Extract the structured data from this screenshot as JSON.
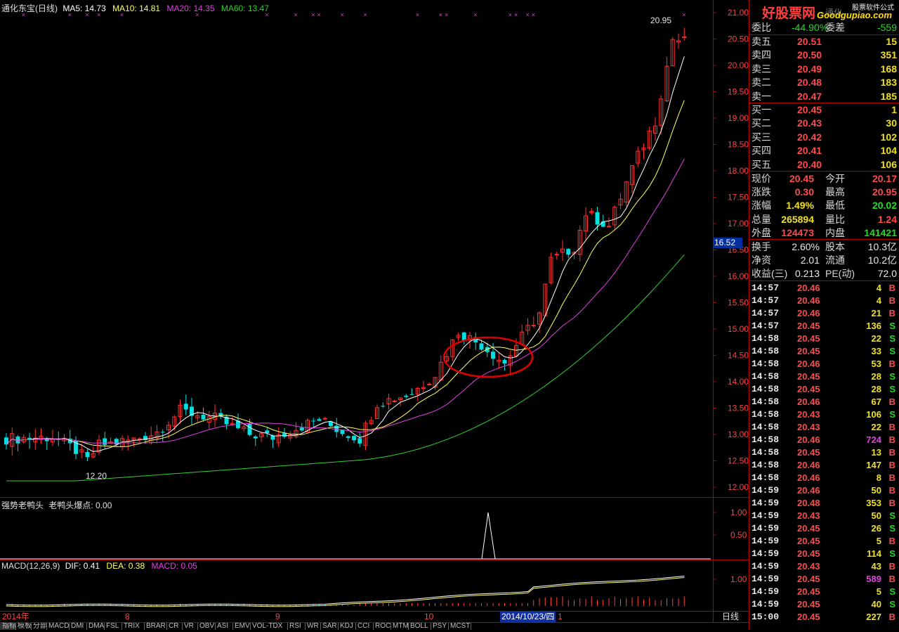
{
  "header": {
    "title": "通化东宝(日线)",
    "ma5": "MA5: 14.73",
    "ma10": "MA10: 14.81",
    "ma20": "MA20: 14.35",
    "ma60": "MA60: 13.47"
  },
  "price_axis": [
    "21.00",
    "20.50",
    "20.00",
    "19.50",
    "19.00",
    "18.50",
    "18.00",
    "17.50",
    "17.00",
    "16.50",
    "16.00",
    "15.50",
    "15.00",
    "14.50",
    "14.00",
    "13.50",
    "13.00",
    "12.50",
    "12.00"
  ],
  "cursor_price": "16.52",
  "high_label": "20.95",
  "low_label": "12.20",
  "indicator1": {
    "name": "强势老鸭头",
    "value_label": "老鸭头爆点: 0.00",
    "axis": [
      "1.00",
      "0.50"
    ]
  },
  "macd": {
    "name": "MACD(12,26,9)",
    "dif": "DIF: 0.41",
    "dea": "DEA: 0.38",
    "macd": "MACD: 0.05",
    "axis": [
      "1.00"
    ]
  },
  "time_axis": {
    "year": "2014年",
    "m8": "8",
    "m9": "9",
    "m10": "10",
    "cursor_date": "2014/10/23/四",
    "m11": "1",
    "period": "日线"
  },
  "tabs": [
    "指标",
    "模板",
    "分部",
    "MACD",
    "DMI",
    "DMA",
    "FSL",
    "TRIX",
    "BRAR",
    "CR",
    "VR",
    "OBV",
    "ASI",
    "EMV",
    "VOL-TDX",
    "RSI",
    "WR",
    "SAR",
    "KDJ",
    "CCI",
    "ROC",
    "MTM",
    "BOLL",
    "PSY",
    "MCST"
  ],
  "watermark": {
    "brand": "好股票网",
    "url": "Goodgupiao.com",
    "note": "股票软件公式",
    "name": "通化"
  },
  "ratio": {
    "label1": "委比",
    "value1": "-44.90%",
    "label2": "委差",
    "value2": "-559"
  },
  "sell": [
    {
      "label": "卖五",
      "price": "20.51",
      "vol": "15"
    },
    {
      "label": "卖四",
      "price": "20.50",
      "vol": "351"
    },
    {
      "label": "卖三",
      "price": "20.49",
      "vol": "168"
    },
    {
      "label": "卖二",
      "price": "20.48",
      "vol": "183"
    },
    {
      "label": "卖一",
      "price": "20.47",
      "vol": "185"
    }
  ],
  "buy": [
    {
      "label": "买一",
      "price": "20.45",
      "vol": "1"
    },
    {
      "label": "买二",
      "price": "20.43",
      "vol": "30"
    },
    {
      "label": "买三",
      "price": "20.42",
      "vol": "102"
    },
    {
      "label": "买四",
      "price": "20.41",
      "vol": "104"
    },
    {
      "label": "买五",
      "price": "20.40",
      "vol": "106"
    }
  ],
  "quote": [
    {
      "l1": "现价",
      "v1": "20.45",
      "l2": "今开",
      "v2": "20.17"
    },
    {
      "l1": "涨跌",
      "v1": "0.30",
      "l2": "最高",
      "v2": "20.95"
    },
    {
      "l1": "涨幅",
      "v1": "1.49%",
      "l2": "最低",
      "v2": "20.02"
    },
    {
      "l1": "总量",
      "v1": "265894",
      "l2": "量比",
      "v2": "1.24"
    },
    {
      "l1": "外盘",
      "v1": "124473",
      "l2": "内盘",
      "v2": "141421"
    }
  ],
  "fund": [
    {
      "l1": "换手",
      "v1": "2.60%",
      "l2": "股本",
      "v2": "10.3亿"
    },
    {
      "l1": "净资",
      "v1": "2.01",
      "l2": "流通",
      "v2": "10.2亿"
    },
    {
      "l1": "收益(三)",
      "v1": "0.213",
      "l2": "PE(动)",
      "v2": "72.0"
    }
  ],
  "ticks": [
    {
      "t": "14:57",
      "p": "20.46",
      "v": "4",
      "s": "B"
    },
    {
      "t": "14:57",
      "p": "20.46",
      "v": "4",
      "s": "B"
    },
    {
      "t": "14:57",
      "p": "20.46",
      "v": "21",
      "s": "B"
    },
    {
      "t": "14:57",
      "p": "20.45",
      "v": "136",
      "s": "S"
    },
    {
      "t": "14:58",
      "p": "20.45",
      "v": "22",
      "s": "S"
    },
    {
      "t": "14:58",
      "p": "20.45",
      "v": "33",
      "s": "S"
    },
    {
      "t": "14:58",
      "p": "20.46",
      "v": "53",
      "s": "B"
    },
    {
      "t": "14:58",
      "p": "20.45",
      "v": "28",
      "s": "S"
    },
    {
      "t": "14:58",
      "p": "20.45",
      "v": "28",
      "s": "S"
    },
    {
      "t": "14:58",
      "p": "20.46",
      "v": "67",
      "s": "B"
    },
    {
      "t": "14:58",
      "p": "20.43",
      "v": "106",
      "s": "S"
    },
    {
      "t": "14:58",
      "p": "20.43",
      "v": "22",
      "s": "B"
    },
    {
      "t": "14:58",
      "p": "20.46",
      "v": "724",
      "s": "B"
    },
    {
      "t": "14:58",
      "p": "20.45",
      "v": "13",
      "s": "B"
    },
    {
      "t": "14:58",
      "p": "20.46",
      "v": "147",
      "s": "B"
    },
    {
      "t": "14:58",
      "p": "20.46",
      "v": "8",
      "s": "B"
    },
    {
      "t": "14:59",
      "p": "20.46",
      "v": "50",
      "s": "B"
    },
    {
      "t": "14:59",
      "p": "20.48",
      "v": "353",
      "s": "B"
    },
    {
      "t": "14:59",
      "p": "20.43",
      "v": "50",
      "s": "S"
    },
    {
      "t": "14:59",
      "p": "20.45",
      "v": "26",
      "s": "S"
    },
    {
      "t": "14:59",
      "p": "20.45",
      "v": "5",
      "s": "B"
    },
    {
      "t": "14:59",
      "p": "20.45",
      "v": "114",
      "s": "S"
    },
    {
      "t": "14:59",
      "p": "20.43",
      "v": "43",
      "s": "B"
    },
    {
      "t": "14:59",
      "p": "20.45",
      "v": "589",
      "s": "B"
    },
    {
      "t": "14:59",
      "p": "20.45",
      "v": "5",
      "s": "S"
    },
    {
      "t": "14:59",
      "p": "20.45",
      "v": "40",
      "s": "S"
    },
    {
      "t": "15:00",
      "p": "20.45",
      "v": "227",
      "s": "B"
    }
  ],
  "colors": {
    "up": "#ff3030",
    "down": "#00e0e0",
    "ma5": "#ffffff",
    "ma10": "#ffff60",
    "ma20": "#e040e0",
    "ma60": "#30d030",
    "border": "#b00000",
    "highlight_vol": "#e040e0"
  }
}
